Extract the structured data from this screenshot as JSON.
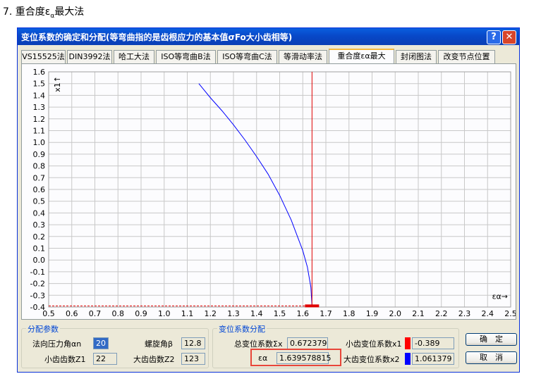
{
  "caption": {
    "prefix": "7. 重合度ε",
    "sub": "α",
    "suffix": "最大法"
  },
  "window": {
    "title": "变位系数的确定和分配(等弯曲指的是齿根应力的基本值σFo大小齿相等)",
    "help_label": "?",
    "close_label": "✕"
  },
  "tabs": [
    {
      "label": "VS15525法",
      "active": false
    },
    {
      "label": "DIN3992法",
      "active": false
    },
    {
      "label": "哈工大法",
      "active": false
    },
    {
      "label": "ISO等弯曲B法",
      "active": false
    },
    {
      "label": "ISO等弯曲C法",
      "active": false
    },
    {
      "label": "等滑动率法",
      "active": false
    },
    {
      "label": "重合度εα最大",
      "active": true
    },
    {
      "label": "封闭图法",
      "active": false
    },
    {
      "label": "改变节点位置",
      "active": false
    }
  ],
  "chart_data": {
    "type": "line",
    "xlabel": "εα→",
    "ylabel": "x1↑",
    "xlim": [
      0.5,
      2.5
    ],
    "ylim": [
      -0.4,
      1.6
    ],
    "xticks": [
      "0.5",
      "0.6",
      "0.7",
      "0.8",
      "0.9",
      "1.0",
      "1.1",
      "1.2",
      "1.3",
      "1.4",
      "1.5",
      "1.6",
      "1.7",
      "1.8",
      "1.9",
      "2.0",
      "2.1",
      "2.2",
      "2.3",
      "2.4",
      "2.5"
    ],
    "yticks": [
      "1.6",
      "1.5",
      "1.4",
      "1.3",
      "1.2",
      "1.1",
      "1.0",
      "0.9",
      "0.8",
      "0.7",
      "0.6",
      "0.5",
      "0.4",
      "0.3",
      "0.2",
      "0.1",
      "0.0",
      "-0.1",
      "-0.2",
      "-0.3",
      "-0.4"
    ],
    "grid": true,
    "series": [
      {
        "color": "#0000ff",
        "x": [
          1.15,
          1.2,
          1.25,
          1.3,
          1.35,
          1.4,
          1.45,
          1.5,
          1.55,
          1.6,
          1.62,
          1.635,
          1.64
        ],
        "y": [
          1.5,
          1.38,
          1.27,
          1.15,
          1.02,
          0.88,
          0.73,
          0.55,
          0.34,
          0.08,
          -0.06,
          -0.23,
          -0.39
        ]
      }
    ],
    "vline": {
      "x": 1.64,
      "color": "#e00000"
    },
    "hline": {
      "y": -0.39,
      "x_from": 0.5,
      "x_to": 1.64,
      "color": "#e00000"
    },
    "marker": {
      "x": 1.64,
      "y": -0.39,
      "color": "#e00000"
    }
  },
  "params": {
    "legend": "分配参数",
    "alpha_n_label": "法向压力角αn",
    "alpha_n_value": "20",
    "beta_label": "螺旋角β",
    "beta_value": "12.8",
    "z1_label": "小齿齿数Z1",
    "z1_value": "22",
    "z2_label": "大齿齿数Z2",
    "z2_value": "123"
  },
  "coeffs": {
    "legend": "变位系数分配",
    "sum_label": "总变位系数Σx",
    "sum_value": "0.672379",
    "eps_label": "εα",
    "eps_value": "1.639578815",
    "x1_label": "小齿变位系数x1",
    "x1_value": "-0.389",
    "x1_color": "#ff0000",
    "x2_label": "大齿变位系数x2",
    "x2_value": "1.061379",
    "x2_color": "#0000ff"
  },
  "buttons": {
    "ok_label": "确　定",
    "cancel_label": "取　消"
  }
}
